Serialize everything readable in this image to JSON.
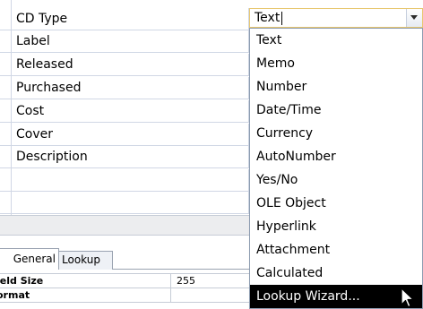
{
  "field_grid": {
    "rows": [
      {
        "name": "CD Type"
      },
      {
        "name": "Label"
      },
      {
        "name": "Released"
      },
      {
        "name": "Purchased"
      },
      {
        "name": "Cost"
      },
      {
        "name": "Cover"
      },
      {
        "name": "Description"
      },
      {
        "name": ""
      },
      {
        "name": ""
      }
    ]
  },
  "data_type_combo": {
    "value": "Text",
    "icon": "chevron-down-icon"
  },
  "data_type_dropdown": {
    "options": [
      "Text",
      "Memo",
      "Number",
      "Date/Time",
      "Currency",
      "AutoNumber",
      "Yes/No",
      "OLE Object",
      "Hyperlink",
      "Attachment",
      "Calculated",
      "Lookup Wizard..."
    ],
    "highlighted": "Lookup Wizard..."
  },
  "property_tabs": {
    "general_label": "General",
    "lookup_label": "Lookup"
  },
  "properties": [
    {
      "label": "ield Size",
      "value": "255"
    },
    {
      "label": "ormat",
      "value": ""
    }
  ],
  "colors": {
    "selection_background": "#000000",
    "selection_text": "#ffffff",
    "combo_focus_border": "#e8c770",
    "grid_line": "#d0d7e5"
  },
  "pointer_icon": "mouse-pointer-icon"
}
